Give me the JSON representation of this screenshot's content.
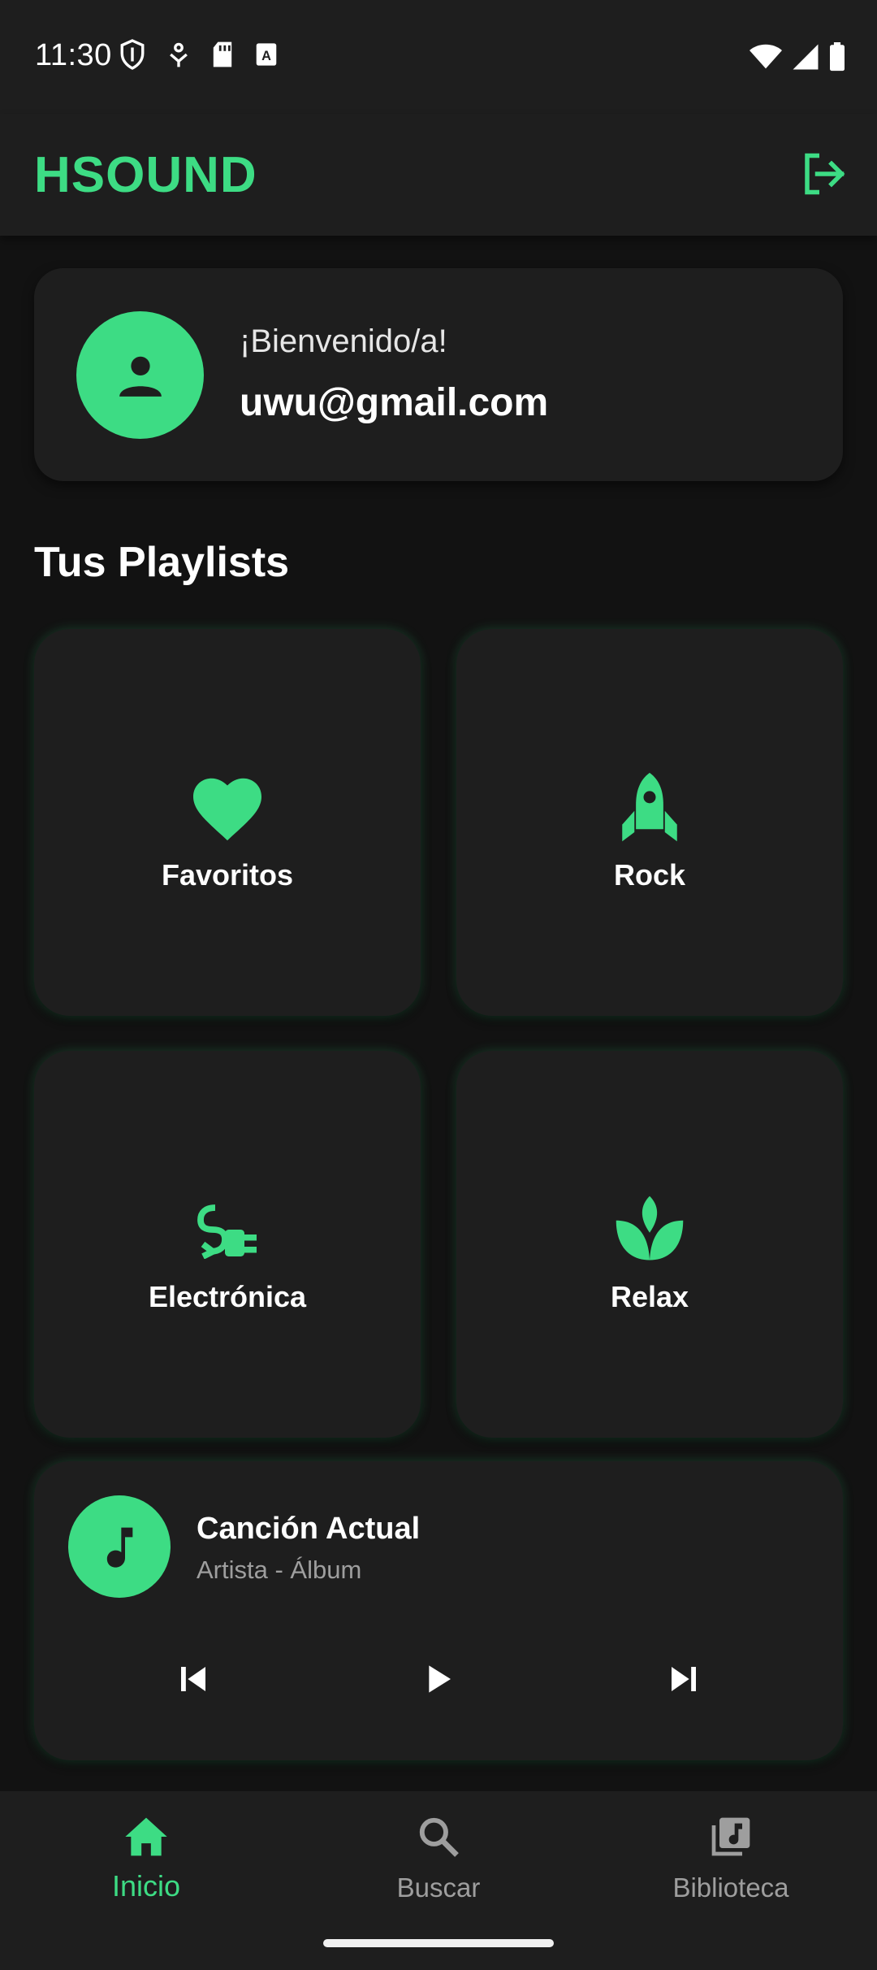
{
  "status_bar": {
    "time": "11:30",
    "left_icons": [
      "shield-icon",
      "usb-icon",
      "sd-card-icon",
      "text-icon"
    ],
    "right_icons": [
      "wifi-icon",
      "signal-icon",
      "battery-icon"
    ]
  },
  "app_bar": {
    "title": "HSOUND",
    "action_icon": "logout-icon"
  },
  "welcome": {
    "greeting": "¡Bienvenido/a!",
    "email": "uwu@gmail.com",
    "avatar_icon": "person-icon"
  },
  "playlists_section": {
    "title": "Tus Playlists",
    "items": [
      {
        "label": "Favoritos",
        "icon": "heart-icon"
      },
      {
        "label": "Rock",
        "icon": "rocket-icon"
      },
      {
        "label": "Electrónica",
        "icon": "plug-icon"
      },
      {
        "label": "Relax",
        "icon": "spa-icon"
      }
    ]
  },
  "player": {
    "title": "Canción Actual",
    "subtitle": "Artista - Álbum",
    "art_icon": "music-note-icon",
    "controls": [
      "skip-previous-icon",
      "play-icon",
      "skip-next-icon"
    ]
  },
  "bottom_nav": {
    "items": [
      {
        "label": "Inicio",
        "icon": "home-icon",
        "active": true
      },
      {
        "label": "Buscar",
        "icon": "search-icon",
        "active": false
      },
      {
        "label": "Biblioteca",
        "icon": "library-music-icon",
        "active": false
      }
    ]
  },
  "colors": {
    "accent": "#3ddc84",
    "background": "#121212",
    "surface": "#1e1e1e",
    "text_primary": "#ffffff",
    "text_secondary": "#9e9e9e"
  }
}
